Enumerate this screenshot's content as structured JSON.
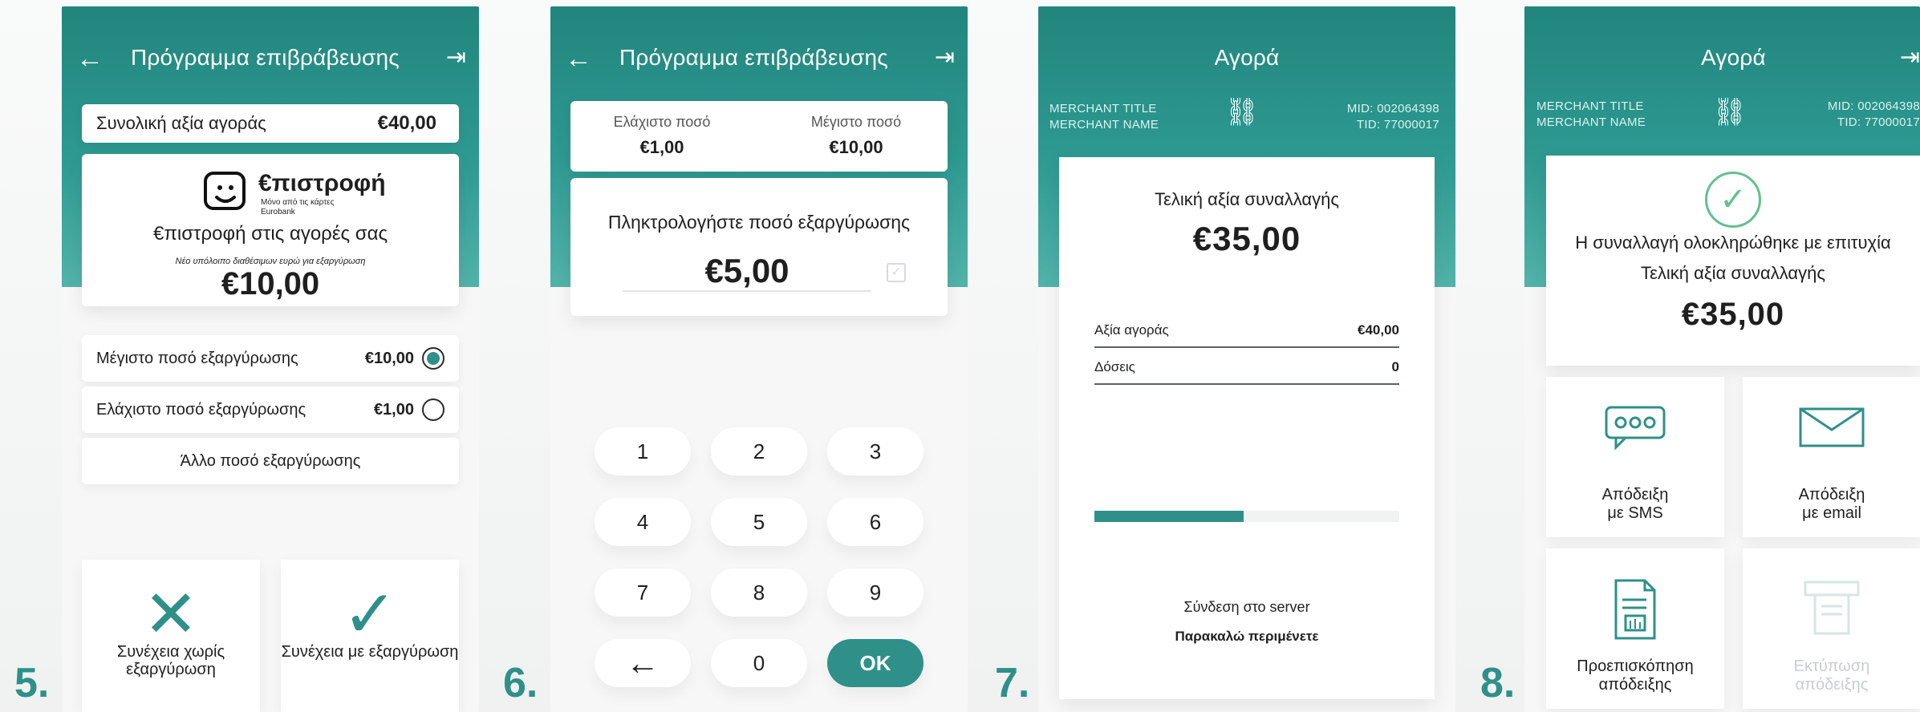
{
  "steps": [
    "5.",
    "6.",
    "7.",
    "8."
  ],
  "screen5": {
    "title": "Πρόγραμμα επιβράβευσης",
    "back_icon": "back-arrow-icon",
    "exit_icon": "exit-icon",
    "total_label": "Συνολική αξία αγοράς",
    "total_value": "€40,00",
    "brand_name": "€πιστροφή",
    "brand_tagline_1": "Μόνο από τις κάρτες",
    "brand_tagline_2": "Eurobank",
    "subtitle": "€πιστροφή στις αγορές σας",
    "balance_label": "Νέο υπόλοιπο διαθέσιμων ευρώ για εξαργύρωση",
    "balance_value": "€10,00",
    "options": [
      {
        "label": "Μέγιστο ποσό εξαργύρωσης",
        "value": "€10,00",
        "selected": true
      },
      {
        "label": "Ελάχιστο ποσό εξαργύρωσης",
        "value": "€1,00",
        "selected": false
      }
    ],
    "other_amount": "Άλλο ποσό εξαργύρωσης",
    "continue_without": "Συνέχεια χωρίς εξαργύρωση",
    "continue_with": "Συνέχεια με εξαργύρωση"
  },
  "screen6": {
    "title": "Πρόγραμμα επιβράβευσης",
    "min_label": "Ελάχιστο ποσό",
    "min_value": "€1,00",
    "max_label": "Μέγιστο ποσό",
    "max_value": "€10,00",
    "prompt": "Πληκτρολογήστε ποσό εξαργύρωσης",
    "amount": "€5,00",
    "keys": [
      "1",
      "2",
      "3",
      "4",
      "5",
      "6",
      "7",
      "8",
      "9",
      "←",
      "0",
      "OK"
    ]
  },
  "screen7": {
    "title": "Αγορά",
    "merchant_title": "MERCHANT TITLE",
    "merchant_name": "MERCHANT NAME",
    "mid": "MID: 002064398",
    "tid": "TID: 77000017",
    "final_label": "Τελική αξία συναλλαγής",
    "final_value": "€35,00",
    "purchase_label": "Αξία αγοράς",
    "purchase_value": "€40,00",
    "installments_label": "Δόσεις",
    "installments_value": "0",
    "progress": 0.49,
    "status_line": "Σύνδεση στο server",
    "wait_line": "Παρακαλώ περιμένετε"
  },
  "screen8": {
    "title": "Αγορά",
    "merchant_title": "MERCHANT TITLE",
    "merchant_name": "MERCHANT NAME",
    "mid": "MID: 002064398",
    "tid": "TID: 77000017",
    "success_text": "Η συναλλαγή ολοκληρώθηκε με επιτυχία",
    "final_label": "Τελική αξία συναλλαγής",
    "final_value": "€35,00",
    "options": [
      {
        "label_1": "Απόδειξη",
        "label_2": "με SMS",
        "icon": "sms-icon",
        "enabled": true
      },
      {
        "label_1": "Απόδειξη",
        "label_2": "με email",
        "icon": "email-icon",
        "enabled": true
      },
      {
        "label_1": "Προεπισκόπηση",
        "label_2": "απόδειξης",
        "icon": "preview-receipt-icon",
        "enabled": true
      },
      {
        "label_1": "Εκτύπωση",
        "label_2": "απόδειξης",
        "icon": "print-receipt-icon",
        "enabled": false
      }
    ]
  }
}
